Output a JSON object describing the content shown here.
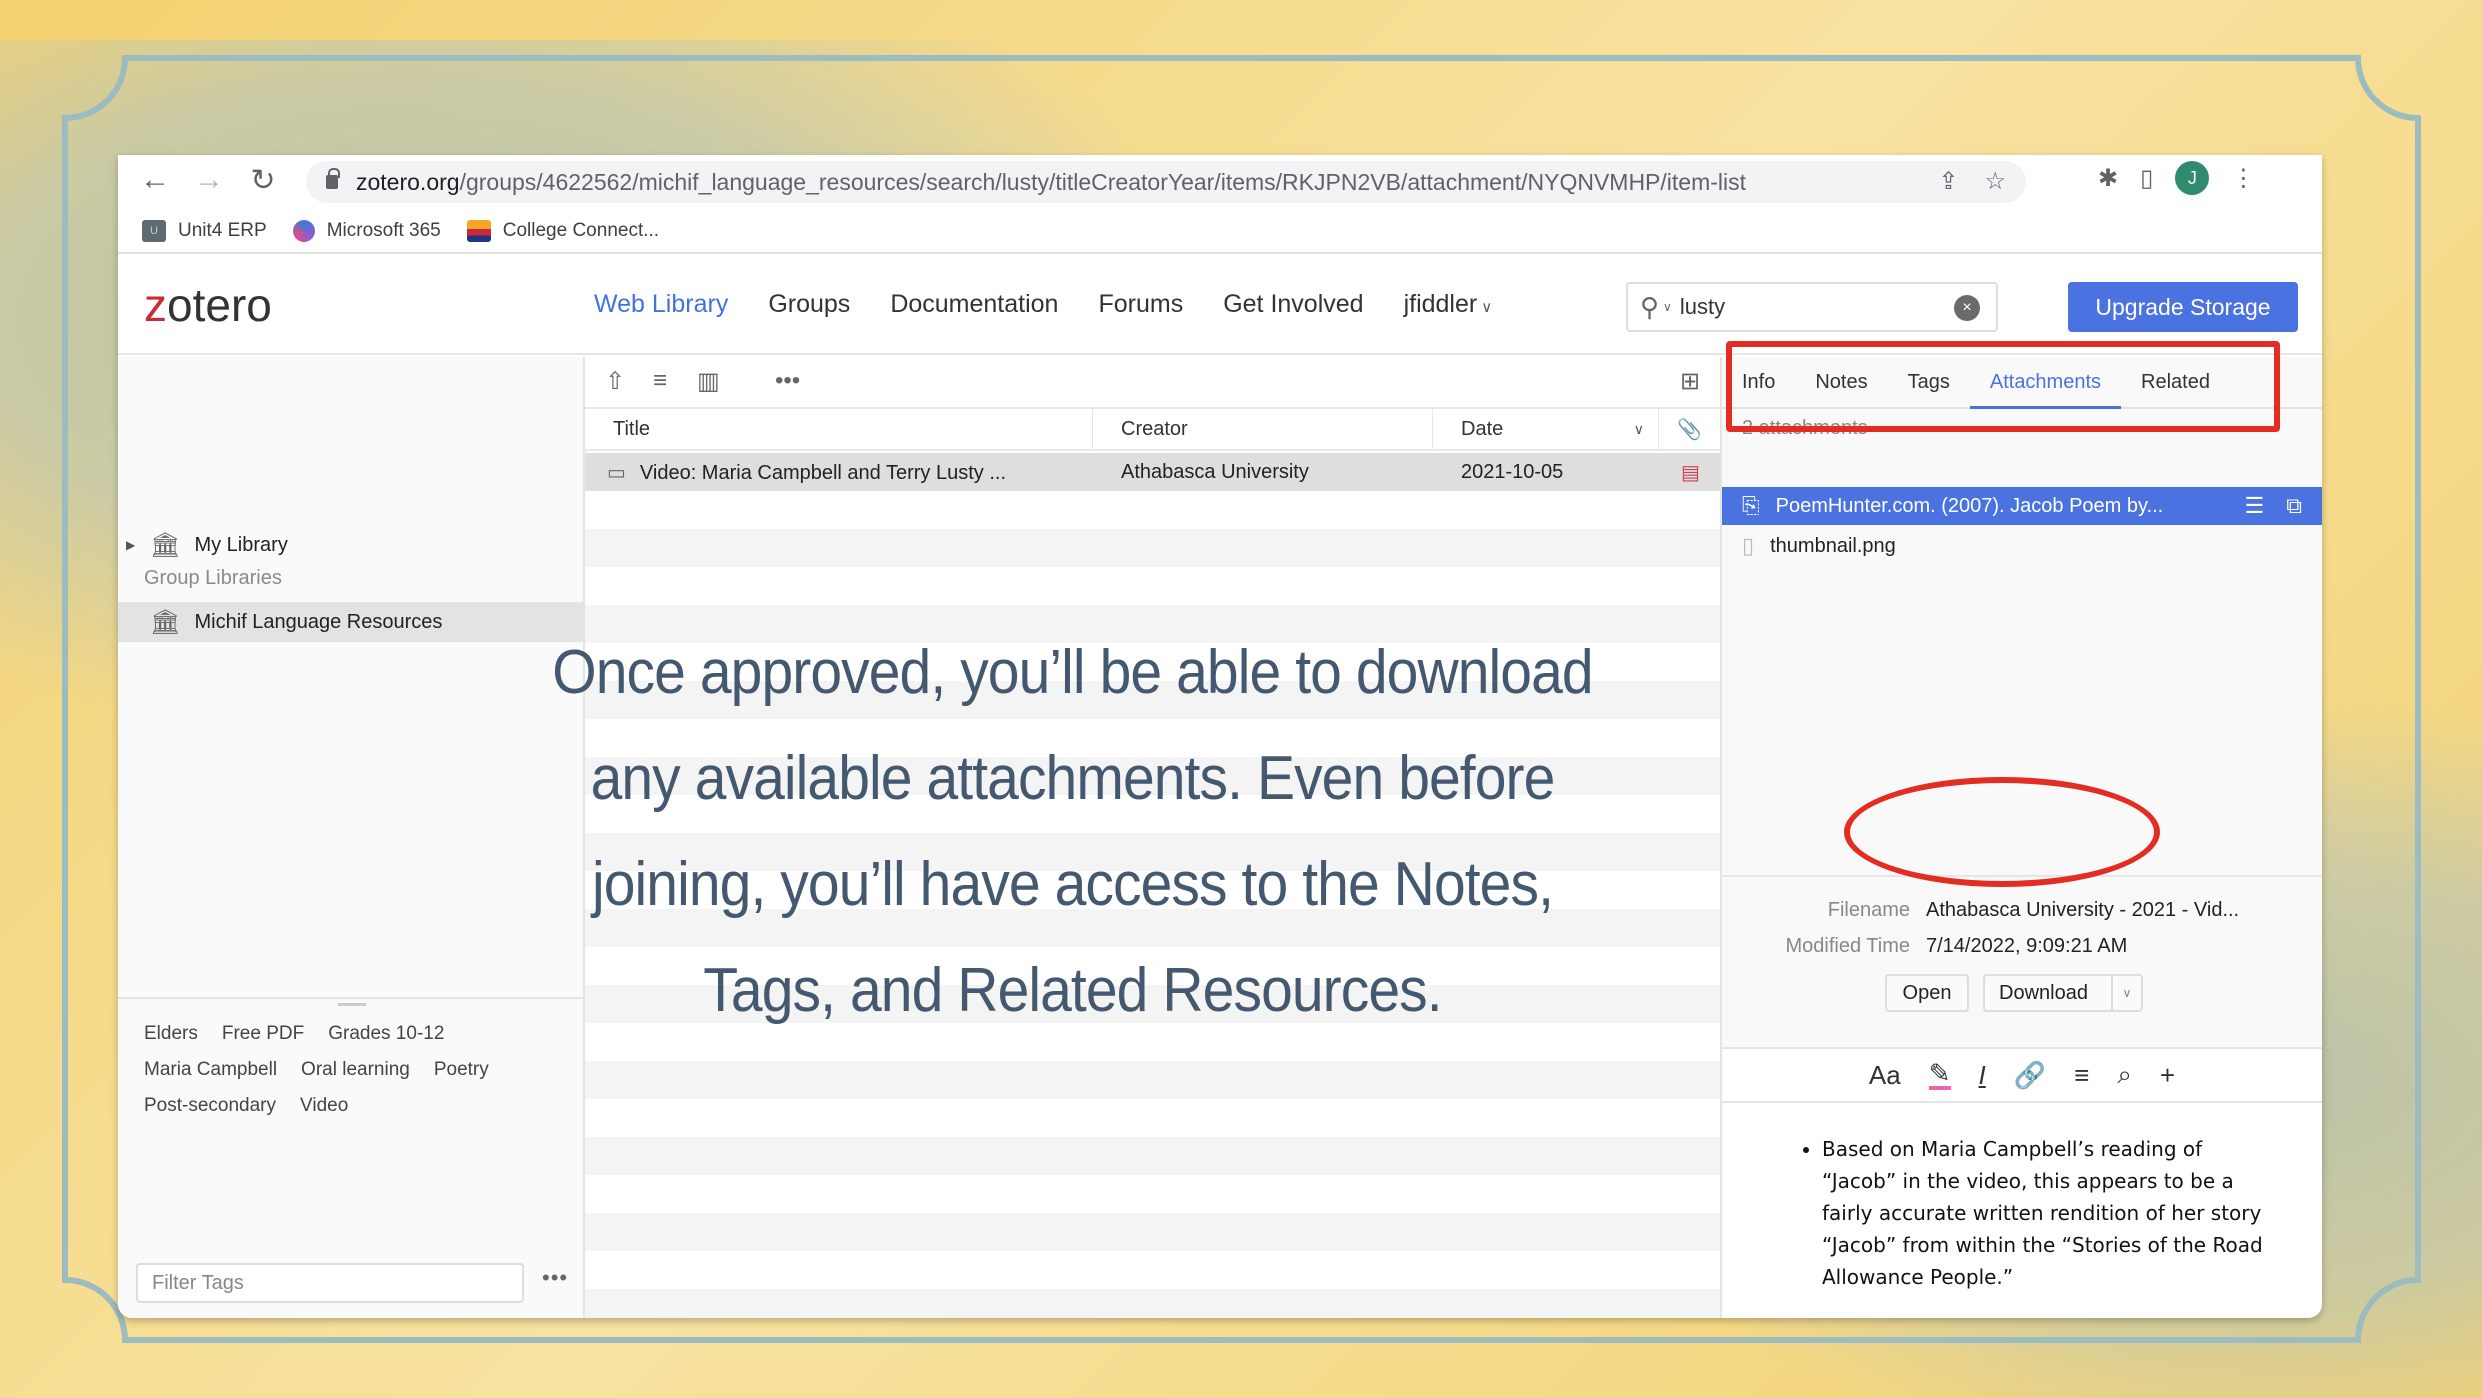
{
  "browser": {
    "url_domain": "zotero.org",
    "url_path": "/groups/4622562/michif_language_resources/search/lusty/titleCreatorYear/items/RKJPN2VB/attachment/NYQNVMHP/item-list",
    "avatar_initial": "J",
    "bookmarks": [
      {
        "label": "Unit4 ERP",
        "icon": "unit4-icon"
      },
      {
        "label": "Microsoft 365",
        "icon": "microsoft365-icon"
      },
      {
        "label": "College Connect...",
        "icon": "college-connect-icon"
      }
    ]
  },
  "header": {
    "logo_z": "z",
    "logo_rest": "otero",
    "nav": [
      {
        "label": "Web Library",
        "active": true
      },
      {
        "label": "Groups"
      },
      {
        "label": "Documentation"
      },
      {
        "label": "Forums"
      },
      {
        "label": "Get Involved"
      },
      {
        "label": "jfiddler"
      }
    ],
    "search_value": "lusty",
    "upgrade_label": "Upgrade Storage",
    "accent_color": "#4a72e0"
  },
  "left_pane": {
    "my_library": "My Library",
    "group_libraries_label": "Group Libraries",
    "group": "Michif Language Resources",
    "tags": [
      "Elders",
      "Free PDF",
      "Grades 10-12",
      "Maria Campbell",
      "Oral learning",
      "Poetry",
      "Post-secondary",
      "Video"
    ],
    "filter_placeholder": "Filter Tags"
  },
  "items": {
    "columns": [
      "Title",
      "Creator",
      "Date"
    ],
    "rows": [
      {
        "title": "Video: Maria Campbell and Terry Lusty ...",
        "creator": "Athabasca University",
        "date": "2021-10-05"
      }
    ]
  },
  "item_pane": {
    "tabs": [
      "Info",
      "Notes",
      "Tags",
      "Attachments",
      "Related"
    ],
    "active_tab": "Attachments",
    "attachment_count": "2 attachments",
    "attachments": [
      {
        "name": "PoemHunter.com. (2007). Jacob Poem by...",
        "selected": true
      },
      {
        "name": "thumbnail.png",
        "selected": false
      }
    ],
    "filename_label": "Filename",
    "filename_value": "Athabasca University - 2021 - Vid...",
    "modified_label": "Modified Time",
    "modified_value": "7/14/2022, 9:09:21 AM",
    "open_label": "Open",
    "download_label": "Download",
    "note_toolbar": [
      "Aa",
      "highlight",
      "clear-format",
      "link",
      "align",
      "search",
      "add"
    ],
    "note_text": "Based on Maria Campbell’s reading of “Jacob” in the video, this appears to be a fairly accurate written rendition of her story “Jacob” from within the “Stories of the Road Allowance People.”"
  },
  "overlay": {
    "lines": [
      "Once approved, you’ll be able to download",
      "any available attachments. Even before",
      "joining, you’ll have access to the Notes,",
      "Tags, and Related Resources."
    ],
    "annotation_color": "#e42d22"
  }
}
